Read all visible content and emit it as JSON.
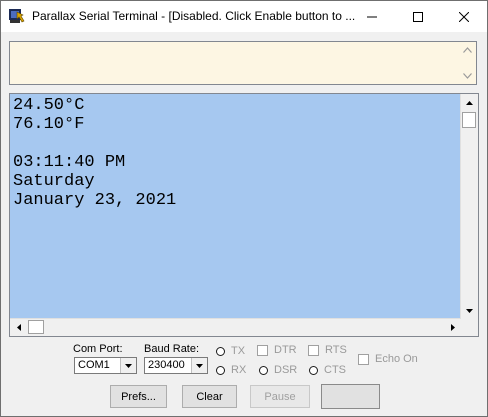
{
  "window": {
    "title": "Parallax Serial Terminal - [Disabled. Click Enable button to ...",
    "icon": "parallax-terminal-icon"
  },
  "transmit": {
    "text": ""
  },
  "receive": {
    "lines": [
      "24.50°C",
      "76.10°F",
      "",
      "03:11:40 PM",
      "Saturday",
      "January 23, 2021"
    ]
  },
  "controls": {
    "com_port_label": "Com Port:",
    "com_port_value": "COM1",
    "baud_rate_label": "Baud Rate:",
    "baud_rate_value": "230400",
    "tx": "TX",
    "rx": "RX",
    "dtr": "DTR",
    "dsr": "DSR",
    "rts": "RTS",
    "cts": "CTS",
    "echo_on": "Echo On"
  },
  "buttons": {
    "prefs": "Prefs...",
    "clear": "Clear",
    "pause": "Pause",
    "enable": ""
  }
}
